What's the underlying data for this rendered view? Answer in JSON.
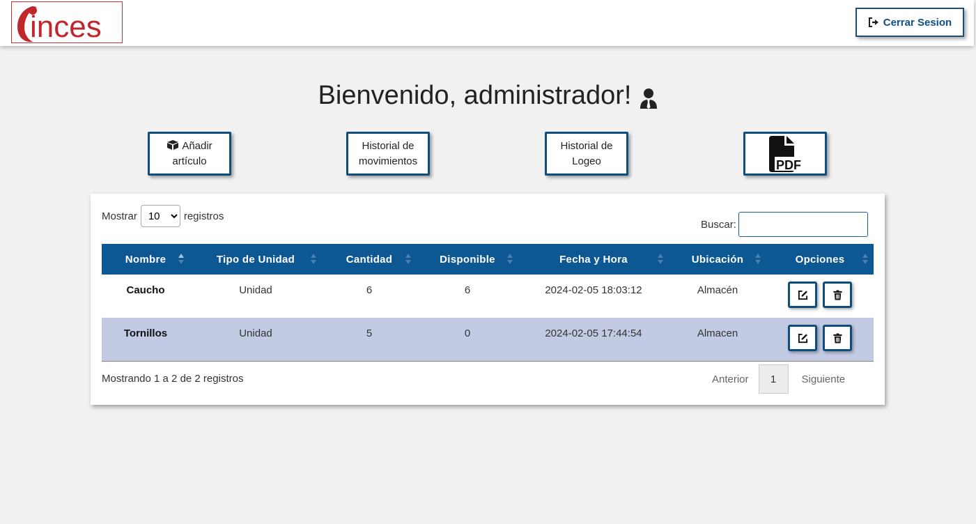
{
  "header": {
    "logo_text": "inces",
    "logout_label": "Cerrar Sesion",
    "logout_icon": "sign-out-icon"
  },
  "welcome": {
    "text": "Bienvenido, administrador!",
    "icon": "user-tie-icon"
  },
  "actions": {
    "add_item": {
      "line1": "Añadir",
      "line2": "artículo",
      "icon": "boxes-icon"
    },
    "movement_history": {
      "line1": "Historial de",
      "line2": "movimientos"
    },
    "login_history": {
      "line1": "Historial de",
      "line2": "Logeo"
    },
    "pdf": {
      "icon": "file-pdf-icon",
      "text": "PDF"
    }
  },
  "table_controls": {
    "show_label": "Mostrar",
    "page_size": "10",
    "records_label": "registros",
    "search_label": "Buscar:",
    "search_value": ""
  },
  "table": {
    "columns": [
      "Nombre",
      "Tipo de Unidad",
      "Cantidad",
      "Disponible",
      "Fecha y Hora",
      "Ubicación",
      "Opciones"
    ],
    "rows": [
      {
        "nombre": "Caucho",
        "tipo": "Unidad",
        "cantidad": "6",
        "disponible": "6",
        "fecha": "2024-02-05 18:03:12",
        "ubicacion": "Almacén"
      },
      {
        "nombre": "Tornillos",
        "tipo": "Unidad",
        "cantidad": "5",
        "disponible": "0",
        "fecha": "2024-02-05 17:44:54",
        "ubicacion": "Almacen"
      }
    ]
  },
  "footer": {
    "info": "Mostrando 1 a 2 de 2 registros",
    "prev": "Anterior",
    "page": "1",
    "next": "Siguiente"
  },
  "colors": {
    "primary": "#0d5893",
    "border_blue": "#0e4e7e",
    "row_alt": "#c3cae3",
    "logo_red": "#c0272d",
    "background": "#f1f1f1"
  }
}
